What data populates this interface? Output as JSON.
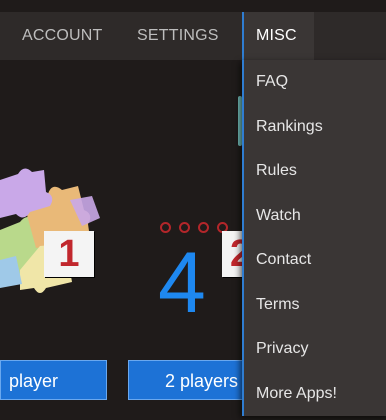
{
  "nav": {
    "items": [
      {
        "label": "ACCOUNT"
      },
      {
        "label": "SETTINGS"
      },
      {
        "label": "MISC"
      }
    ],
    "active": "MISC"
  },
  "misc_menu": {
    "items": [
      {
        "label": "FAQ"
      },
      {
        "label": "Rankings"
      },
      {
        "label": "Rules"
      },
      {
        "label": "Watch"
      },
      {
        "label": "Contact"
      },
      {
        "label": "Terms"
      },
      {
        "label": "Privacy"
      },
      {
        "label": "More Apps!"
      }
    ]
  },
  "game": {
    "big_digit": "4",
    "card_one": "1",
    "card_two": "2",
    "buttons": {
      "one_player": "player",
      "two_players": "2 players"
    }
  },
  "colors": {
    "accent": "#2f7dd1",
    "button_blue": "#1d72d6",
    "digit_blue": "#1e88f0",
    "card_red": "#c1272d"
  }
}
